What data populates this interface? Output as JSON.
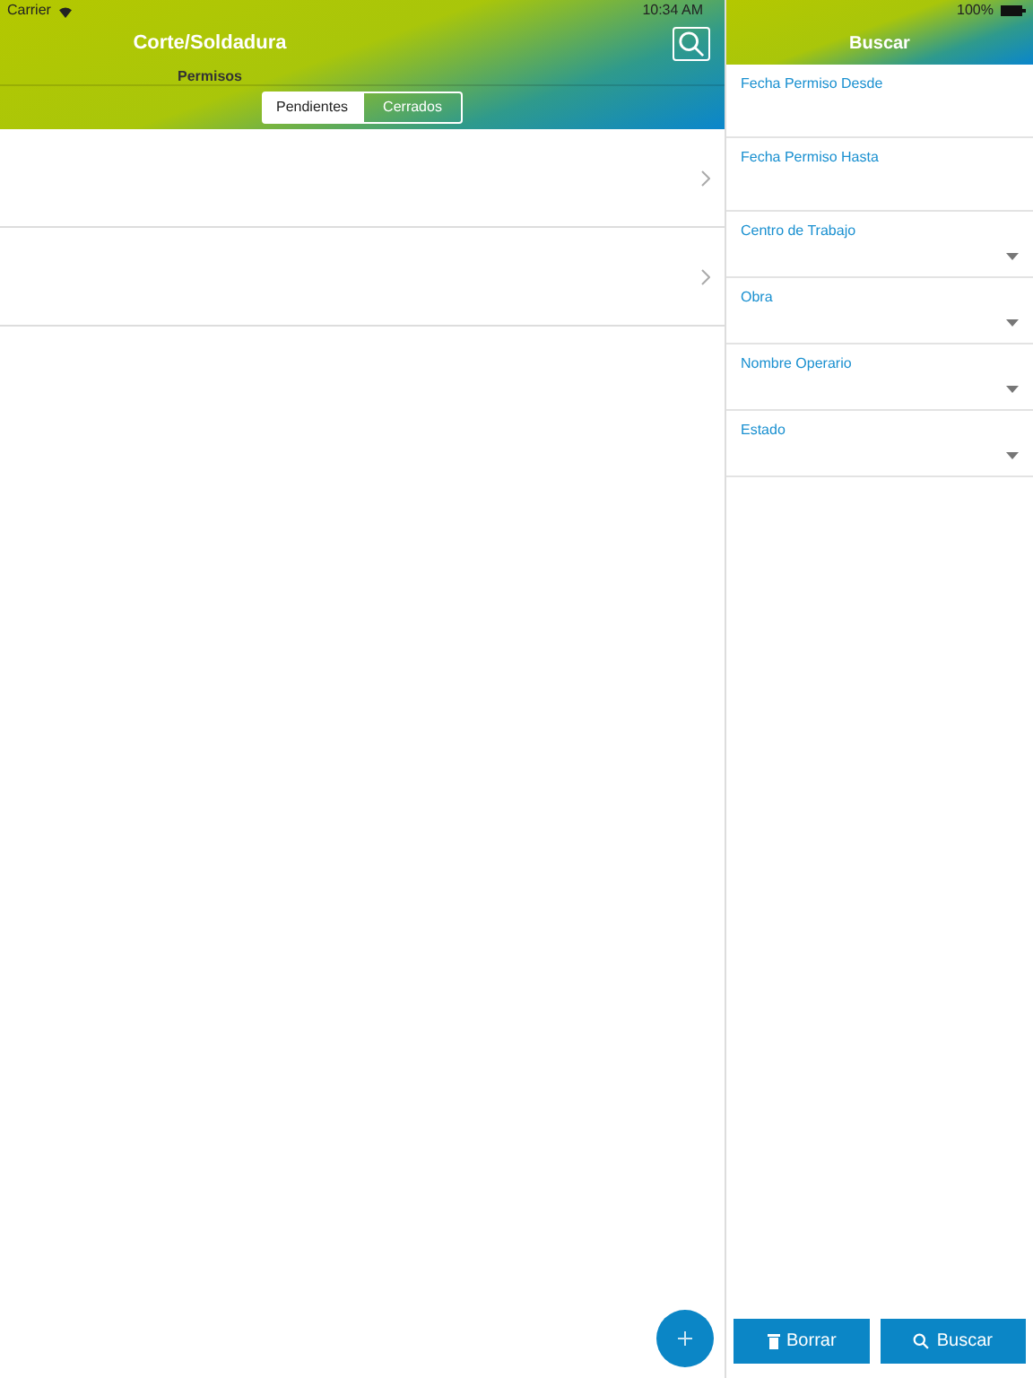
{
  "status_bar": {
    "carrier": "Carrier",
    "time": "10:34 AM",
    "battery": "100%"
  },
  "header": {
    "title": "Corte/Soldadura",
    "subtitle": "Permisos"
  },
  "segments": [
    {
      "label": "Pendientes",
      "selected": true
    },
    {
      "label": "Cerrados",
      "selected": false
    }
  ],
  "list_rows": [
    {
      "kind": "row"
    },
    {
      "kind": "row"
    }
  ],
  "search_panel": {
    "title": "Buscar",
    "fields": [
      {
        "label": "Fecha Permiso Desde",
        "kind": "date"
      },
      {
        "label": "Fecha Permiso Hasta",
        "kind": "date"
      },
      {
        "label": "Centro de Trabajo",
        "kind": "select"
      },
      {
        "label": "Obra",
        "kind": "select"
      },
      {
        "label": "Nombre Operario",
        "kind": "select"
      },
      {
        "label": "Estado",
        "kind": "select"
      }
    ],
    "buttons": [
      {
        "label": "Borrar",
        "kind": "clear"
      },
      {
        "label": "Buscar",
        "kind": "search"
      }
    ]
  }
}
